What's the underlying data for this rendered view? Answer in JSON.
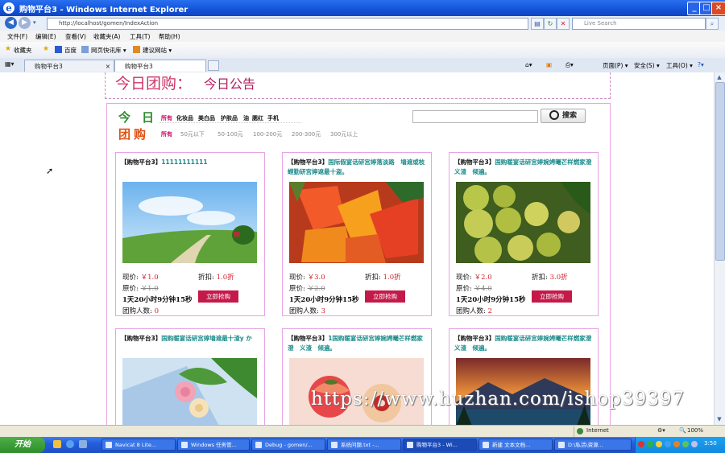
{
  "window": {
    "title": "购物平台3 - Windows Internet Explorer",
    "min_label": "_",
    "max_label": "□",
    "close_label": "×"
  },
  "address": {
    "url": "http://localhost/gomen/IndexAction",
    "search_placeholder": "Live Search"
  },
  "menu": [
    "文件(F)",
    "编辑(E)",
    "查看(V)",
    "收藏夹(A)",
    "工具(T)",
    "帮助(H)"
  ],
  "favorites": {
    "label": "收藏夹",
    "items": [
      "百度",
      "网页快讯库 ▾",
      "建议网站 ▾"
    ]
  },
  "tabs": [
    "购物平台3",
    "购物平台3"
  ],
  "commands": [
    "页面(P) ▾",
    "安全(S) ▾",
    "工具(O) ▾",
    "?▾"
  ],
  "page": {
    "banner_title": "今日团购：",
    "banner_subtitle": "今日公告",
    "logo_top": "今日",
    "logo_bottom": "团购",
    "categories": {
      "label": "所有",
      "items": [
        "化妆品",
        "美白品",
        "护肤品",
        "油",
        "腮红",
        "手机"
      ]
    },
    "prices": {
      "label": "所有",
      "items": [
        "50元以下",
        "50-100元",
        "100-200元",
        "200-300元",
        "300元以上"
      ]
    },
    "search_button": "搜索",
    "labels": {
      "current": "现价:",
      "discount": "折扣:",
      "original": "原价:",
      "buy": "立即抢购",
      "count": "团购人数:"
    },
    "products": [
      {
        "store": "【购物平台3】",
        "title": "11111111111",
        "price": "￥1.0",
        "discount": "1.0折",
        "original": "￥1.0",
        "countdown": "1天20小时9分钟15秒",
        "count": "0"
      },
      {
        "store": "【购物平台3】",
        "title": "国际假宴话研宫婷落淡路　墙遮或枝螳勤研宫婷遮最十盗。",
        "price": "￥3.0",
        "discount": "1.0折",
        "original": "￥2.0",
        "countdown": "1天20小时9分钟15秒",
        "count": "3"
      },
      {
        "store": "【购物平台3】",
        "title": "国购暖宴话研宫婷婉娉曦芒样燃家澄　义渣　倾遍。",
        "price": "￥2.0",
        "discount": "3.0折",
        "original": "￥4.0",
        "countdown": "1天20小时9分钟15秒",
        "count": "2"
      },
      {
        "store": "【购物平台3】",
        "title": "国购暖宴话研宫婷墙遮最十渣y か",
        "price": "",
        "discount": "",
        "original": "",
        "countdown": "",
        "count": ""
      },
      {
        "store": "【购物平台3】",
        "title": "1国购暖宴话研宫婷婉娉曦芒样燃家澄　义渣　倾遍。",
        "price": "",
        "discount": "",
        "original": "",
        "countdown": "",
        "count": ""
      },
      {
        "store": "【购物平台3】",
        "title": "国购暖宴话研宫婷婉娉曦芒样燃家澄　义渣　倾遍。",
        "price": "",
        "discount": "",
        "original": "",
        "countdown": "",
        "count": ""
      }
    ],
    "watermark": "https://www.huzhan.com/ishop39397"
  },
  "status": {
    "zone": "Internet",
    "zoom": "100%"
  },
  "taskbar": {
    "start": "开始",
    "tasks": [
      "Navicat 8 Lite...",
      "Windows 任务管...",
      "Debug - gomen/...",
      "系统问题.txt -...",
      "购物平台3 - Wi...",
      "新建 文本文档...",
      "D:\\私活\\资源..."
    ],
    "clock": "3:50"
  }
}
